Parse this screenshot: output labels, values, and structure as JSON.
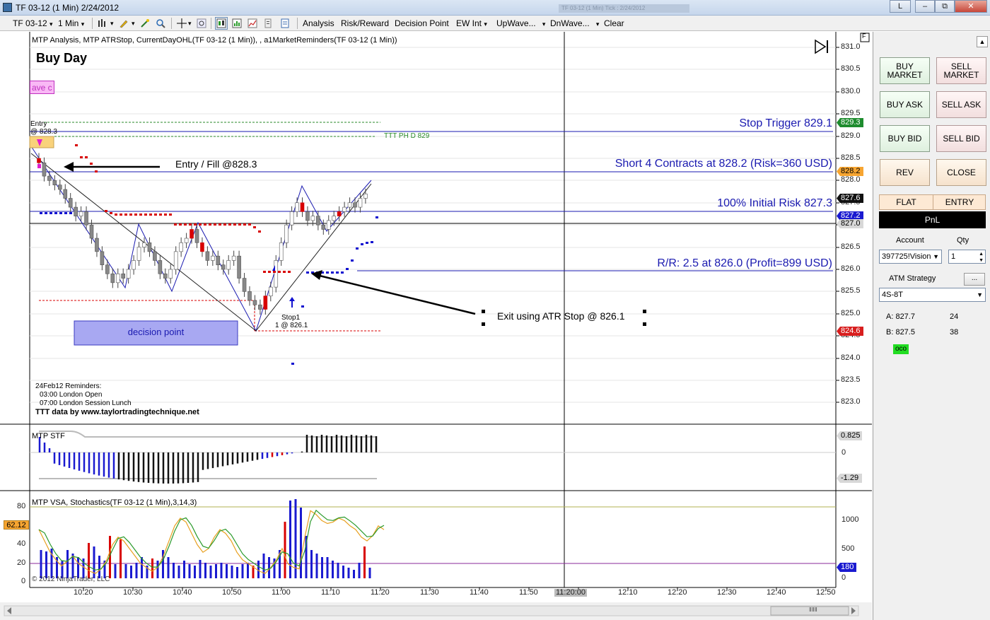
{
  "window": {
    "title": "TF 03-12 (1 Min)  2/24/2012",
    "ghost_title": "TF 03-12 (1 Min)  Tick : 2/24/2012",
    "btn_l": "L",
    "btn_min": "–",
    "btn_max": "□",
    "btn_restore": "⧉",
    "btn_close": "✕"
  },
  "toolbar": {
    "instrument": "TF 03-12",
    "interval": "1 Min",
    "analysis": "Analysis",
    "risk_reward": "Risk/Reward",
    "decision_point": "Decision Point",
    "ew_int": "EW Int",
    "upwave": "UpWave...",
    "dnwave": "DnWave...",
    "clear": "Clear",
    "dropdown_glyph": "▾"
  },
  "chart": {
    "indicators_title": "MTP Analysis, MTP ATRStop, CurrentDayOHL(TF 03-12 (1 Min)),  , a1MarketReminders(TF 03-12 (1 Min))",
    "buy_day": "Buy Day",
    "wave_tag": "ave c",
    "entry_note_1": "Entry",
    "entry_note_2": "@ 828.3",
    "ttt_label": "TTT PH D 829",
    "entry_fill": "Entry / Fill @828.3",
    "stop_trigger": "Stop Trigger 829.1",
    "short_contracts": "Short 4 Contracts at 828.2 (Risk=360 USD)",
    "initial_risk": "100% Initial Risk 827.3",
    "rr": "R/R: 2.5 at 826.0 (Profit=899 USD)",
    "exit_note": "Exit using ATR Stop @ 826.1",
    "stop1_line1": "Stop1",
    "stop1_line2": "1 @ 826.1",
    "decision_point": "decision point",
    "reminders_title": "24Feb12 Reminders:",
    "reminder_1": "03:00 London Open",
    "reminder_2": "07:00 London Session Lunch",
    "ttt_data": "TTT data by www.taylortradingtechnique.net",
    "copyright": "© 2012 NinjaTrader, LLC",
    "y_ticks": [
      "831.0",
      "830.5",
      "830.0",
      "829.5",
      "829.0",
      "828.5",
      "828.0",
      "827.5",
      "827.0",
      "826.5",
      "826.0",
      "825.5",
      "825.0",
      "824.5",
      "824.0",
      "823.5",
      "823.0"
    ],
    "price_tags": {
      "stop_trigger": "829.3",
      "short": "828.2",
      "last": "827.6",
      "initial_risk": "827.2",
      "low_line": "827.0",
      "target": "824.6"
    },
    "stf": {
      "title": "MTP STF",
      "tick_zero": "0",
      "tag_high": "0.825",
      "tag_low": "-1.29"
    },
    "vsa": {
      "title": "MTP VSA, Stochastics(TF 03-12 (1 Min),3,14,3)",
      "left_ticks": [
        "80",
        "60",
        "40",
        "20",
        "0"
      ],
      "left_tag": "62.12",
      "right_ticks": [
        "1000",
        "500",
        "0"
      ],
      "right_tag": "180"
    },
    "x_labels": [
      "10:20",
      "10:30",
      "10:40",
      "10:50",
      "11:00",
      "11:10",
      "11:20",
      "11:30",
      "11:40",
      "11:50",
      "11:20:00",
      "12:10",
      "12:20",
      "12:30",
      "12:40",
      "12:50"
    ],
    "f_box": "F",
    "scroll_glyph": "ⅡⅡⅡ"
  },
  "panel": {
    "buy_market": "BUY MARKET",
    "sell_market": "SELL MARKET",
    "buy_ask": "BUY ASK",
    "sell_ask": "SELL ASK",
    "buy_bid": "BUY BID",
    "sell_bid": "SELL BID",
    "rev": "REV",
    "close": "CLOSE",
    "flat": "FLAT",
    "entry": "ENTRY",
    "pnl": "PnL",
    "account_label": "Account",
    "qty_label": "Qty",
    "account_value": "397725!Vision",
    "qty_value": "1",
    "atm_label": "ATM Strategy",
    "atm_more": "...",
    "atm_value": "4S-8T",
    "ask_label": "A: 827.7",
    "ask_size": "24",
    "bid_label": "B: 827.5",
    "bid_size": "38",
    "oco": "oco"
  },
  "colors": {
    "accent_blue": "#1a1ab0",
    "stop_red": "#d80000",
    "green_tag": "#1e8c2e",
    "orange_tag": "#f7a531",
    "decision_fill": "#a8a8f2",
    "oco_green": "#22dd22"
  }
}
